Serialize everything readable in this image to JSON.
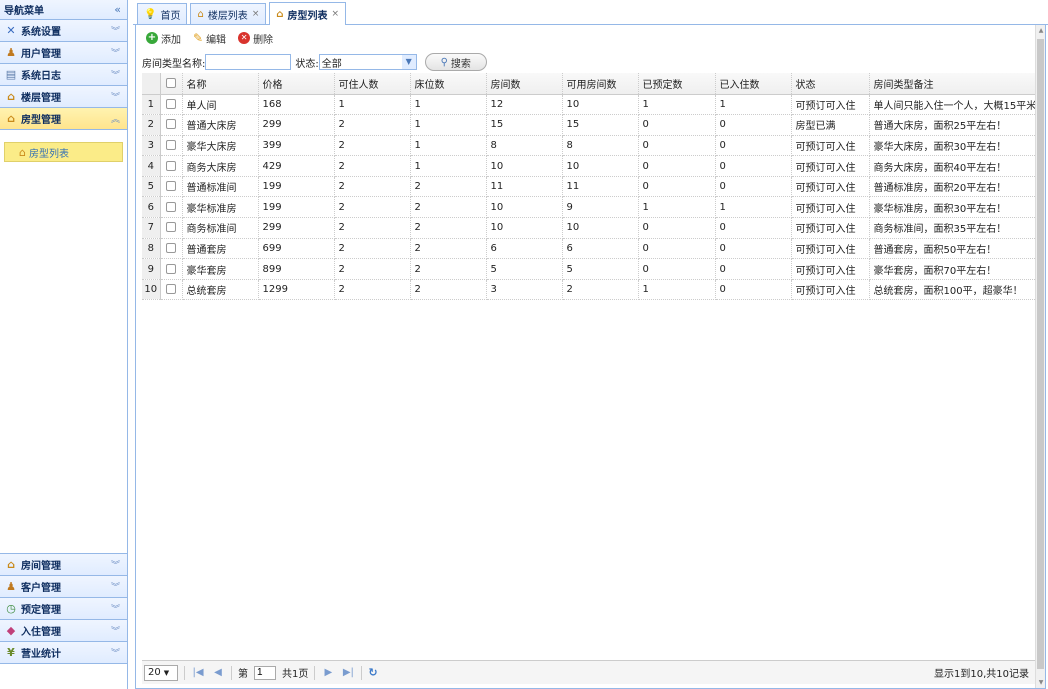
{
  "nav": {
    "title": "导航菜单",
    "collapse_icon": "«",
    "sections": [
      {
        "label": "系统设置",
        "icon": "tools-icon"
      },
      {
        "label": "用户管理",
        "icon": "users-icon"
      },
      {
        "label": "系统日志",
        "icon": "log-icon"
      },
      {
        "label": "楼层管理",
        "icon": "house-icon"
      },
      {
        "label": "房型管理",
        "icon": "house-icon"
      }
    ],
    "active_sub": "房型列表",
    "bottom_sections": [
      {
        "label": "房间管理"
      },
      {
        "label": "客户管理"
      },
      {
        "label": "预定管理"
      },
      {
        "label": "入住管理"
      },
      {
        "label": "营业统计"
      }
    ]
  },
  "tabs": [
    {
      "label": "首页"
    },
    {
      "label": "楼层列表"
    },
    {
      "label": "房型列表"
    }
  ],
  "toolbar": {
    "add": "添加",
    "edit": "编辑",
    "delete": "删除"
  },
  "search": {
    "name_label": "房间类型名称:",
    "name_value": "",
    "status_label": "状态:",
    "status_value": "全部",
    "button": "搜索"
  },
  "table": {
    "columns": [
      "名称",
      "价格",
      "可住人数",
      "床位数",
      "房间数",
      "可用房间数",
      "已预定数",
      "已入住数",
      "状态",
      "房间类型备注"
    ],
    "rows": [
      [
        "1",
        "单人间",
        "168",
        "1",
        "1",
        "12",
        "10",
        "1",
        "1",
        "可预订可入住",
        "单人间只能入住一个人，大概15平米"
      ],
      [
        "2",
        "普通大床房",
        "299",
        "2",
        "1",
        "15",
        "15",
        "0",
        "0",
        "房型已满",
        "普通大床房，面积25平左右！"
      ],
      [
        "3",
        "豪华大床房",
        "399",
        "2",
        "1",
        "8",
        "8",
        "0",
        "0",
        "可预订可入住",
        "豪华大床房，面积30平左右！"
      ],
      [
        "4",
        "商务大床房",
        "429",
        "2",
        "1",
        "10",
        "10",
        "0",
        "0",
        "可预订可入住",
        "商务大床房，面积40平左右！"
      ],
      [
        "5",
        "普通标准间",
        "199",
        "2",
        "2",
        "11",
        "11",
        "0",
        "0",
        "可预订可入住",
        "普通标准房，面积20平左右！"
      ],
      [
        "6",
        "豪华标准房",
        "199",
        "2",
        "2",
        "10",
        "9",
        "1",
        "1",
        "可预订可入住",
        "豪华标准房，面积30平左右！"
      ],
      [
        "7",
        "商务标准间",
        "299",
        "2",
        "2",
        "10",
        "10",
        "0",
        "0",
        "可预订可入住",
        "商务标准间，面积35平左右！"
      ],
      [
        "8",
        "普通套房",
        "699",
        "2",
        "2",
        "6",
        "6",
        "0",
        "0",
        "可预订可入住",
        "普通套房，面积50平左右！"
      ],
      [
        "9",
        "豪华套房",
        "899",
        "2",
        "2",
        "5",
        "5",
        "0",
        "0",
        "可预订可入住",
        "豪华套房，面积70平左右！"
      ],
      [
        "10",
        "总统套房",
        "1299",
        "2",
        "2",
        "3",
        "2",
        "1",
        "0",
        "可预订可入住",
        "总统套房，面积100平，超豪华！"
      ]
    ]
  },
  "pager": {
    "page_size": "20",
    "page_prefix": "第",
    "page_value": "1",
    "page_total": "共1页",
    "info": "显示1到10,共10记录"
  }
}
